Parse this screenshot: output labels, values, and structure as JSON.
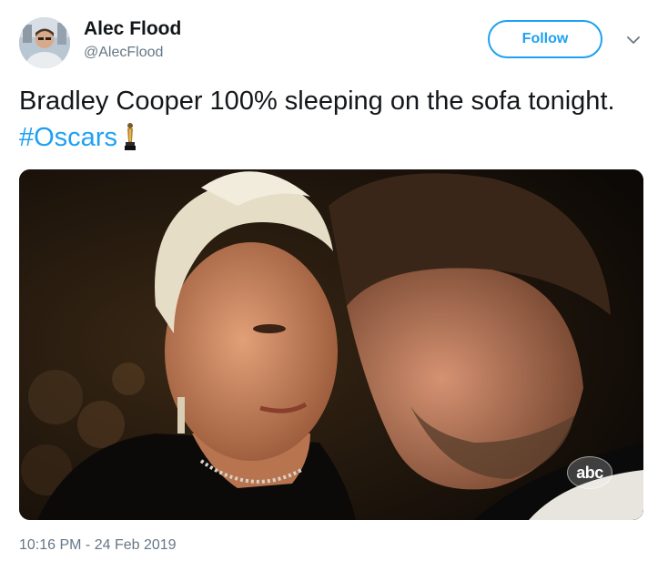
{
  "author": {
    "display_name": "Alec Flood",
    "handle": "@AlecFlood"
  },
  "follow_button": {
    "label": "Follow"
  },
  "tweet": {
    "text": "Bradley Cooper 100% sleeping on the sofa tonight.",
    "hashtag": "#Oscars",
    "emoji_icon": "oscar-trophy-icon"
  },
  "media": {
    "watermark": "abc"
  },
  "timestamp": "10:16 PM - 24 Feb 2019",
  "colors": {
    "accent": "#1da1f2",
    "text": "#14171a",
    "secondary_text": "#657786"
  }
}
